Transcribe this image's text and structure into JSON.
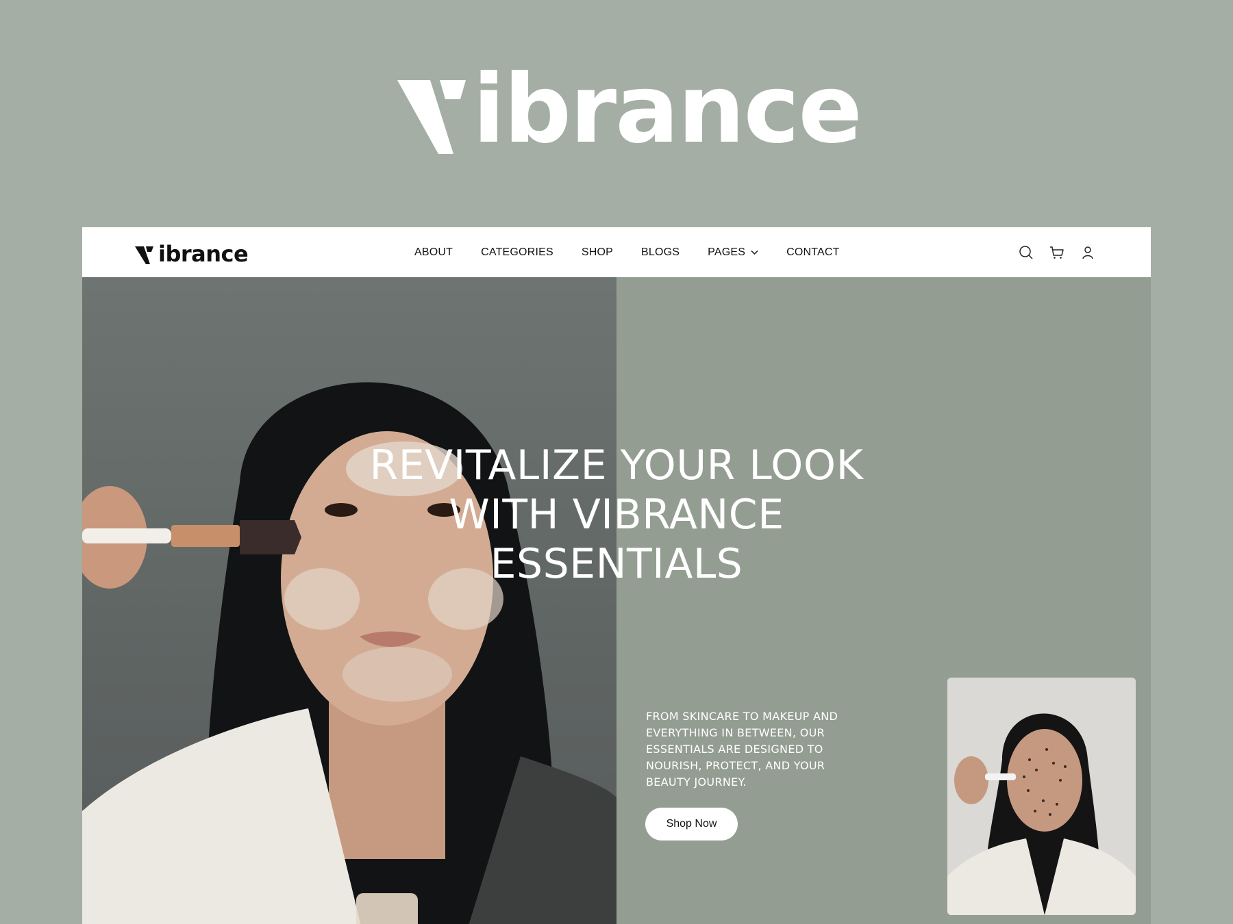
{
  "brand": {
    "name": "Vibrance",
    "wordmark": "ibrance",
    "primary_bg": "#a5aea4",
    "hero_bg": "#949d92",
    "text_color": "#ffffff"
  },
  "nav": {
    "links": [
      {
        "label": "ABOUT"
      },
      {
        "label": "CATEGORIES"
      },
      {
        "label": "SHOP"
      },
      {
        "label": "BLOGS"
      },
      {
        "label": "PAGES",
        "has_dropdown": true
      },
      {
        "label": "CONTACT"
      }
    ],
    "icons": [
      "search-icon",
      "cart-icon",
      "user-icon"
    ]
  },
  "hero": {
    "title_lines": [
      "REVITALIZE YOUR LOOK",
      "WITH VIBRANCE",
      "ESSENTIALS"
    ],
    "description": "FROM SKINCARE TO MAKEUP AND EVERYTHING IN BETWEEN, OUR ESSENTIALS ARE DESIGNED TO NOURISH, PROTECT, AND YOUR BEAUTY JOURNEY.",
    "cta_label": "Shop Now"
  }
}
